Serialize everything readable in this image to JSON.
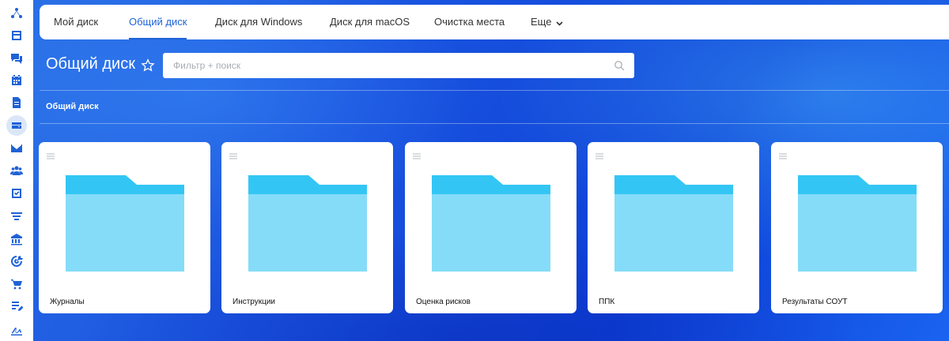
{
  "rail": {
    "items": [
      {
        "icon": "network-icon",
        "name": "rail-item-network"
      },
      {
        "icon": "window-icon",
        "name": "rail-item-window"
      },
      {
        "icon": "chat-icon",
        "name": "rail-item-chat"
      },
      {
        "icon": "calendar-icon",
        "name": "rail-item-calendar"
      },
      {
        "icon": "document-icon",
        "name": "rail-item-documents"
      },
      {
        "icon": "drive-icon",
        "name": "rail-item-drive",
        "active": true
      },
      {
        "icon": "mail-icon",
        "name": "rail-item-mail"
      },
      {
        "icon": "people-icon",
        "name": "rail-item-people"
      },
      {
        "icon": "checkbox-icon",
        "name": "rail-item-tasks"
      },
      {
        "icon": "funnel-icon",
        "name": "rail-item-funnel"
      },
      {
        "icon": "building-icon",
        "name": "rail-item-building"
      },
      {
        "icon": "target-icon",
        "name": "rail-item-target"
      },
      {
        "icon": "cart-icon",
        "name": "rail-item-cart"
      },
      {
        "icon": "list-edit-icon",
        "name": "rail-item-list"
      },
      {
        "icon": "signature-icon",
        "name": "rail-item-sign"
      }
    ],
    "accent": "#1f62d6"
  },
  "tabs": [
    {
      "label": "Мой диск"
    },
    {
      "label": "Общий диск",
      "active": true
    },
    {
      "label": "Диск для Windows"
    },
    {
      "label": "Диск для macOS"
    },
    {
      "label": "Очистка места"
    },
    {
      "label": "Еще"
    }
  ],
  "page": {
    "title": "Общий диск",
    "star_icon": "star-outline-icon"
  },
  "search": {
    "placeholder": "Фильтр + поиск",
    "value": ""
  },
  "breadcrumb": "Общий диск",
  "folders": [
    {
      "label": "Журналы"
    },
    {
      "label": "Инструкции"
    },
    {
      "label": "Оценка рисков"
    },
    {
      "label": "ППК"
    },
    {
      "label": "Результаты СОУТ"
    }
  ],
  "colors": {
    "folder_back": "#33c6f4",
    "folder_front": "#85dcf8",
    "tab_active": "#1f62d6"
  }
}
